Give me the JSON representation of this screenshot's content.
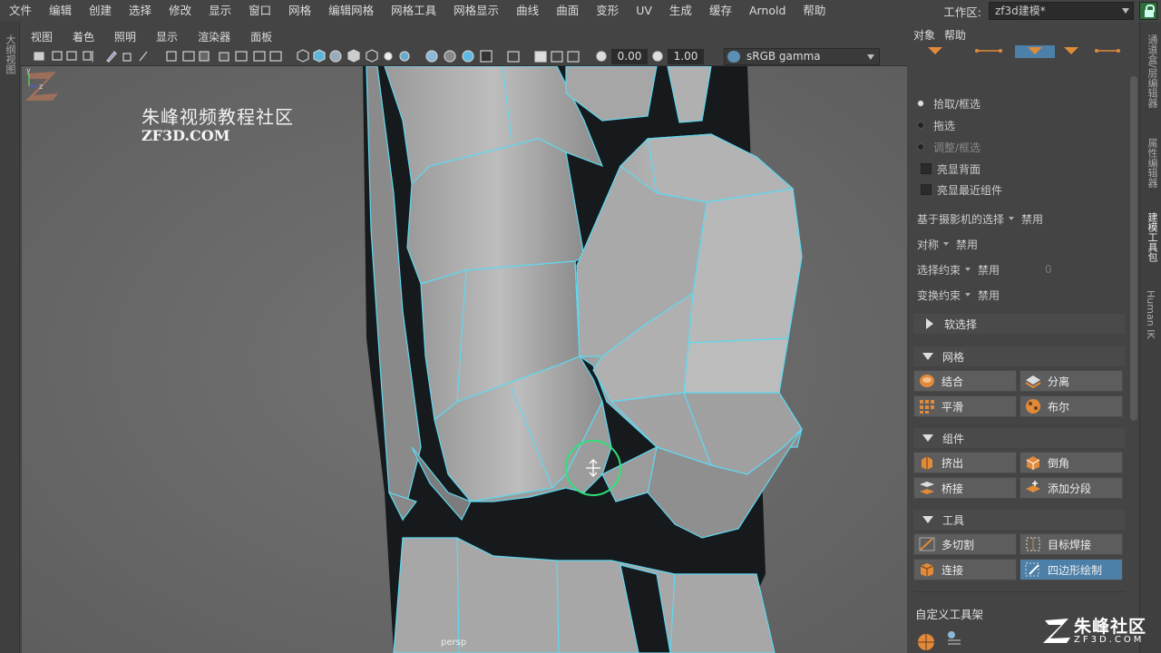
{
  "menubar": {
    "items": [
      "文件",
      "编辑",
      "创建",
      "选择",
      "修改",
      "显示",
      "窗口",
      "网格",
      "编辑网格",
      "网格工具",
      "网格显示",
      "曲线",
      "曲面",
      "变形",
      "UV",
      "生成",
      "缓存",
      "Arnold",
      "帮助"
    ],
    "workspace_label": "工作区:",
    "workspace_value": "zf3d建模*"
  },
  "left_strip": {
    "tab": "大纲视图"
  },
  "panel_menus": [
    "视图",
    "着色",
    "照明",
    "显示",
    "渲染器",
    "面板"
  ],
  "viewport_toolbar": {
    "exposure": "0.00",
    "gamma": "1.00",
    "color_space": "sRGB gamma"
  },
  "viewport": {
    "watermark_title": "朱峰视频教程社区",
    "watermark_sub": "ZF3D.COM",
    "camera": "persp",
    "axis_y": "y",
    "axis_z": "z"
  },
  "right_panel": {
    "menus": [
      "对象",
      "帮助"
    ],
    "radios": [
      {
        "label": "拾取/框选",
        "on": true
      },
      {
        "label": "拖选",
        "on": false
      },
      {
        "label": "调整/框选",
        "on": false
      }
    ],
    "checks": [
      "亮显背面",
      "亮显最近组件"
    ],
    "options": [
      {
        "label": "基于摄影机的选择",
        "value": "禁用",
        "extra": ""
      },
      {
        "label": "对称",
        "value": "禁用",
        "extra": ""
      },
      {
        "label": "选择约束",
        "value": "禁用",
        "extra": "0"
      },
      {
        "label": "变换约束",
        "value": "禁用",
        "extra": ""
      }
    ],
    "soft_select": "软选择",
    "sections": [
      {
        "title": "网格",
        "buttons": [
          "结合",
          "分离",
          "平滑",
          "布尔"
        ]
      },
      {
        "title": "组件",
        "buttons": [
          "挤出",
          "倒角",
          "桥接",
          "添加分段"
        ]
      },
      {
        "title": "工具",
        "buttons": [
          "多切割",
          "目标焊接",
          "连接",
          "四边形绘制"
        ]
      }
    ],
    "custom_shelf": "自定义工具架"
  },
  "right_strip": {
    "tabs": [
      "通道盒/层编辑器",
      "属性编辑器",
      "建模工具包",
      "Human IK"
    ]
  },
  "corner_watermark": {
    "title": "朱峰社区",
    "sub": "ZF3D.COM"
  },
  "colors": {
    "wire": "#5fd8f0",
    "active_button": "#4c80a8",
    "brush_circle": "#2fe27a"
  }
}
